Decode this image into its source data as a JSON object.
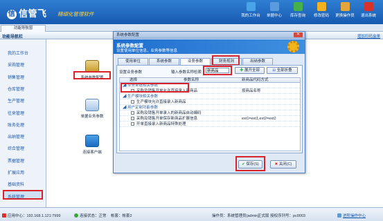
{
  "app": {
    "logo": "信管飞",
    "logo_mark": "信",
    "slogan": "精细化管理软件"
  },
  "topnav": [
    {
      "label": "我的工作台",
      "icon": "monitor-icon",
      "color": "#4aa3e8"
    },
    {
      "label": "单据中心",
      "icon": "documents-icon",
      "color": "#5a9be0"
    },
    {
      "label": "库存查询",
      "icon": "inventory-icon",
      "color": "#46b04a"
    },
    {
      "label": "修改密码",
      "icon": "lock-icon",
      "color": "#f2b11e"
    },
    {
      "label": "更换操作员",
      "icon": "user-switch-icon",
      "color": "#e4a53a"
    },
    {
      "label": "退出系统",
      "icon": "exit-icon",
      "color": "#d9322b"
    }
  ],
  "tab": {
    "label": "功能导航窗"
  },
  "navbar": {
    "title": "功能导航栏",
    "link": "增加扫码盒单"
  },
  "sidebar": {
    "items": [
      "我的工作台",
      "采购管理",
      "销售管理",
      "仓库管理",
      "生产管理",
      "往来管理",
      "账务处理",
      "出纳管理",
      "综合管理",
      "票据管理",
      "扩展应用",
      "基础资料",
      "系统管理"
    ],
    "selected": "系统管理"
  },
  "quickicons": [
    {
      "label": "系统参数配置",
      "icon": "database-icon"
    },
    {
      "label": "单据业务参数",
      "icon": "document-settings-icon"
    },
    {
      "label": "连接客户端",
      "icon": "network-icon"
    }
  ],
  "dialog": {
    "title": "系统参数配置",
    "close": "✕",
    "banner_title": "系统参数配置",
    "banner_sub": "设置使用单位信息，业务参数等信息",
    "tabs": [
      "使用单位",
      "系统参数",
      "业务参数",
      "财务规则",
      "出纳参数"
    ],
    "active_tab": "业务参数",
    "panel_title": "设置业务参数",
    "search_label": "输入参数名称检索",
    "search_value": "新商品",
    "expand_all": "展开全部",
    "collapse_all": "全部折叠",
    "columns": [
      "选择",
      "参数名称",
      "新商品代码方式"
    ],
    "rows": [
      {
        "type": "group",
        "name": "业务单据相关参数"
      },
      {
        "type": "item",
        "name": "采购及销售开单允许直接录入新商品",
        "value": "按商品名称"
      },
      {
        "type": "group",
        "name": "生产模块相关参数"
      },
      {
        "type": "item",
        "name": "生产模块允许直接录入新商品",
        "value": ""
      },
      {
        "type": "group",
        "name": "用户定制功能参数"
      },
      {
        "type": "item",
        "name": "采购及销售开单录入的新商品自动编码",
        "value": ""
      },
      {
        "type": "item",
        "name": "采购及销售开单保存新商品扩展信息",
        "value": "ext1=ext1,ext2=ext2"
      },
      {
        "type": "item",
        "name": "开单直接录入新商品特殊处理",
        "value": ""
      }
    ],
    "save": "保存(S)",
    "close_btn": "关闭(C)"
  },
  "status": {
    "center": "应用中心：192.168.1.121:7999",
    "conn": "连接状态：正常",
    "account": "帐套：帐套2",
    "operator": "操作员：系统管理员(admin)",
    "version": "正式版 授权序列号：pc0003",
    "help": "进阶操作中心"
  }
}
